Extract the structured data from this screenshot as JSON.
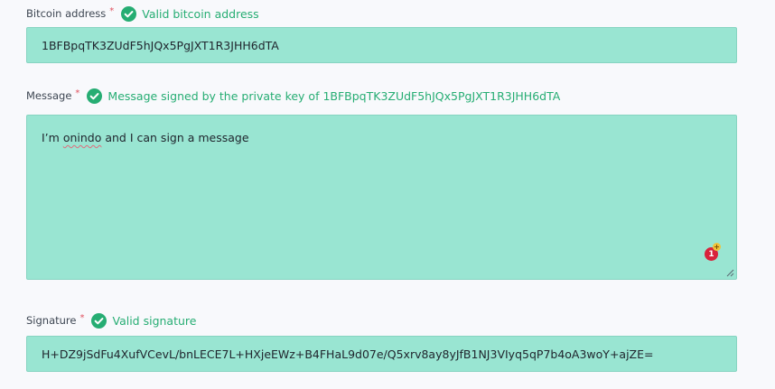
{
  "address": {
    "label": "Bitcoin address",
    "required_mark": "*",
    "status": "Valid bitcoin address",
    "value": "1BFBpqTK3ZUdF5hJQx5PgJXT1R3JHH6dTA"
  },
  "message": {
    "label": "Message",
    "required_mark": "*",
    "status": "Message signed by the private key of 1BFBpqTK3ZUdF5hJQx5PgJXT1R3JHH6dTA",
    "value_before": "I’m ",
    "value_misspelled": "onindo",
    "value_after": " and I can sign a message",
    "badge_count": "1",
    "badge_plus": "+"
  },
  "signature": {
    "label": "Signature",
    "required_mark": "*",
    "status": "Valid signature",
    "value": "H+DZ9jSdFu4XufVCevL/bnLECE7L+HXjeEWz+B4FHaL9d07e/Q5xrv8ay8yJfB1NJ3VIyq5qP7b4oA3woY+ajZE="
  },
  "colors": {
    "valid_green": "#26ad73",
    "field_bg": "#99e5d2",
    "required_red": "#e0515f",
    "badge_red": "#d8233c"
  },
  "icons": {
    "status_icon": "check-circle-icon",
    "resize_icon": "resize-grip-icon",
    "extension_badge": "notification-badge-icon"
  }
}
